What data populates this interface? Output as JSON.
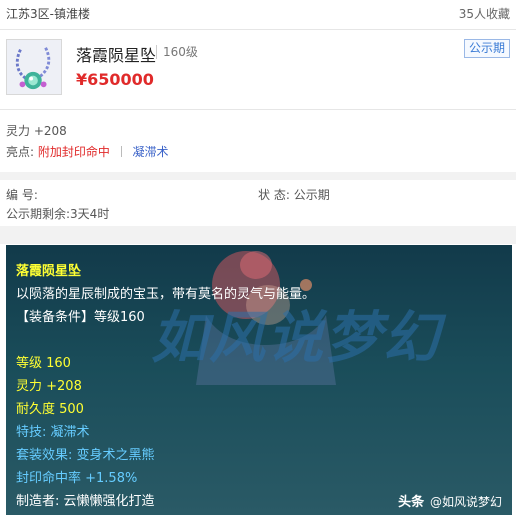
{
  "listing": {
    "server": "江苏3区-镇淮楼",
    "favorites": "35人收藏",
    "item_name": "落霞陨星坠",
    "item_level": "160级",
    "price": "¥650000",
    "status_tag": "公示期"
  },
  "attributes": {
    "line1": "灵力 +208",
    "highlight_label": "亮点:",
    "highlight_value": "附加封印命中",
    "highlight_skill": "凝滞术"
  },
  "meta": {
    "number_label": "编 号:",
    "status_label": "状 态:",
    "status_value": "公示期",
    "countdown_label": "公示期剩余:",
    "countdown_value": "3天4时"
  },
  "tooltip": {
    "name": "落霞陨星坠",
    "description": "以陨落的星辰制成的宝玉，带有莫名的灵气与能量。",
    "requirement": "【装备条件】等级160",
    "stat_level": "等级 160",
    "stat_spirit": "灵力 +208",
    "stat_durability": "耐久度 500",
    "special_skill": "特技:  凝滞术",
    "set_effect": "套装效果: 变身术之黑熊",
    "seal_hit": "封印命中率 +1.58%",
    "maker": "制造者: 云懒懒强化打造"
  },
  "watermark": {
    "text": "如风说梦幻",
    "credit_prefix": "头条",
    "credit_handle": "@如风说梦幻"
  },
  "colors": {
    "price": "#e02a2a",
    "status_tag": "#3a7bd5",
    "tooltip_title": "#ffff33",
    "tooltip_cyan": "#66ccff"
  },
  "icons": [
    "item-thumbnail-amulet"
  ]
}
